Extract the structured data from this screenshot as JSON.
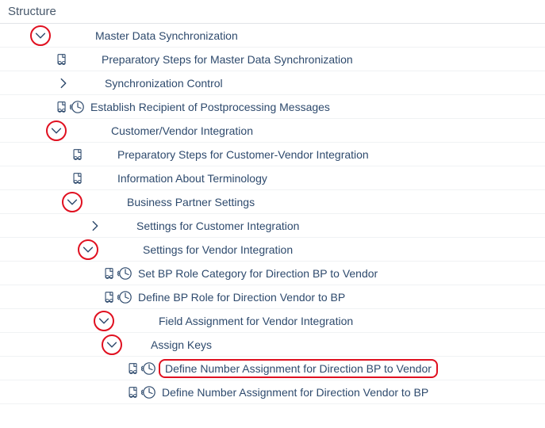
{
  "header": {
    "title": "Structure"
  },
  "rows": [
    {
      "id": "r0",
      "indent": 38,
      "nodeType": "down",
      "ring": true,
      "doc": false,
      "clock": false,
      "label": "Master Data Synchronization",
      "textGap": 52,
      "highlighted": false
    },
    {
      "id": "r1",
      "indent": 68,
      "nodeType": "none",
      "ring": false,
      "doc": true,
      "clock": false,
      "label": "Preparatory Steps for Master Data Synchronization",
      "textGap": 36,
      "highlighted": false
    },
    {
      "id": "r2",
      "indent": 68,
      "nodeType": "right",
      "ring": false,
      "doc": false,
      "clock": false,
      "label": "Synchronization Control",
      "textGap": 36,
      "highlighted": false
    },
    {
      "id": "r3",
      "indent": 68,
      "nodeType": "none",
      "ring": false,
      "doc": true,
      "clock": true,
      "label": "Establish Recipient of Postprocessing Messages",
      "textGap": 2,
      "highlighted": false
    },
    {
      "id": "r4",
      "indent": 58,
      "nodeType": "down",
      "ring": true,
      "doc": false,
      "clock": false,
      "label": "Customer/Vendor Integration",
      "textGap": 52,
      "highlighted": false
    },
    {
      "id": "r5",
      "indent": 88,
      "nodeType": "none",
      "ring": false,
      "doc": true,
      "clock": false,
      "label": "Preparatory Steps for Customer-Vendor Integration",
      "textGap": 36,
      "highlighted": false
    },
    {
      "id": "r6",
      "indent": 88,
      "nodeType": "none",
      "ring": false,
      "doc": true,
      "clock": false,
      "label": "Information About Terminology",
      "textGap": 36,
      "highlighted": false
    },
    {
      "id": "r7",
      "indent": 78,
      "nodeType": "down",
      "ring": true,
      "doc": false,
      "clock": false,
      "label": "Business Partner Settings",
      "textGap": 52,
      "highlighted": false
    },
    {
      "id": "r8",
      "indent": 108,
      "nodeType": "right",
      "ring": false,
      "doc": false,
      "clock": false,
      "label": "Settings for Customer Integration",
      "textGap": 36,
      "highlighted": false
    },
    {
      "id": "r9",
      "indent": 98,
      "nodeType": "down",
      "ring": true,
      "doc": false,
      "clock": false,
      "label": "Settings for Vendor Integration",
      "textGap": 52,
      "highlighted": false
    },
    {
      "id": "r10",
      "indent": 128,
      "nodeType": "none",
      "ring": false,
      "doc": true,
      "clock": true,
      "label": "Set BP Role Category for Direction BP to Vendor",
      "textGap": 2,
      "highlighted": false
    },
    {
      "id": "r11",
      "indent": 128,
      "nodeType": "none",
      "ring": false,
      "doc": true,
      "clock": true,
      "label": "Define BP Role for Direction Vendor to BP",
      "textGap": 2,
      "highlighted": false
    },
    {
      "id": "r12",
      "indent": 118,
      "nodeType": "down",
      "ring": true,
      "doc": false,
      "clock": false,
      "label": "Field Assignment for Vendor Integration",
      "textGap": 52,
      "highlighted": false
    },
    {
      "id": "r13",
      "indent": 128,
      "nodeType": "down",
      "ring": true,
      "doc": false,
      "clock": false,
      "label": "Assign Keys",
      "textGap": 32,
      "highlighted": false
    },
    {
      "id": "r14",
      "indent": 158,
      "nodeType": "none",
      "ring": false,
      "doc": true,
      "clock": true,
      "label": "Define Number Assignment for Direction BP to Vendor",
      "textGap": 2,
      "highlighted": true
    },
    {
      "id": "r15",
      "indent": 158,
      "nodeType": "none",
      "ring": false,
      "doc": true,
      "clock": true,
      "label": "Define Number Assignment for Direction Vendor to BP",
      "textGap": 2,
      "highlighted": false
    }
  ]
}
